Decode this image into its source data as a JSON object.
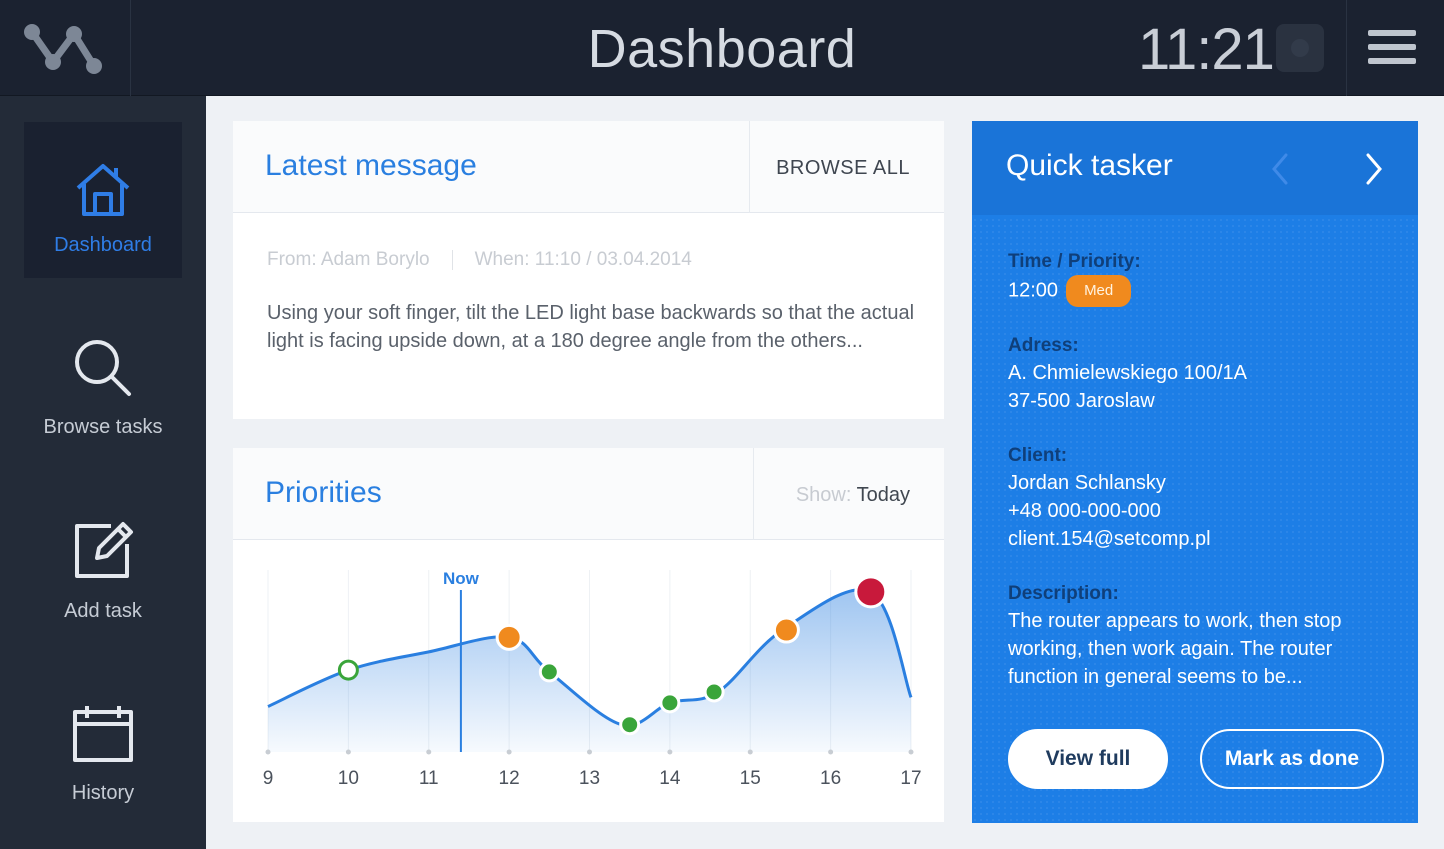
{
  "header": {
    "title": "Dashboard",
    "time": "11:21",
    "logo_icon": "network-logo-icon",
    "settings_icon": "toggle-icon",
    "menu_icon": "hamburger-menu-icon"
  },
  "sidebar": {
    "items": [
      {
        "label": "Dashboard",
        "icon": "home-icon",
        "active": true
      },
      {
        "label": "Browse tasks",
        "icon": "search-icon",
        "active": false
      },
      {
        "label": "Add task",
        "icon": "edit-icon",
        "active": false
      },
      {
        "label": "History",
        "icon": "calendar-icon",
        "active": false
      }
    ]
  },
  "latest_message": {
    "title": "Latest message",
    "browse_all": "BROWSE ALL",
    "from": "From: Adam Borylo",
    "when": "When: 11:10  /  03.04.2014",
    "body": "Using your soft finger, tilt the LED light base backwards so that the actual light is facing upside down, at a 180 degree angle from the others..."
  },
  "priorities": {
    "title": "Priorities",
    "show_label": "Show:",
    "show_value": "Today",
    "now_label": "Now"
  },
  "chart_data": {
    "type": "area",
    "x_ticks": [
      "9",
      "10",
      "11",
      "12",
      "13",
      "14",
      "15",
      "16",
      "17"
    ],
    "xlim": [
      9,
      17
    ],
    "now": 11.4,
    "grid": "vertical",
    "series_curve": [
      {
        "x": 9.0,
        "y": 0.25
      },
      {
        "x": 10.0,
        "y": 0.45
      },
      {
        "x": 11.0,
        "y": 0.55
      },
      {
        "x": 12.0,
        "y": 0.63
      },
      {
        "x": 12.5,
        "y": 0.44
      },
      {
        "x": 13.4,
        "y": 0.15
      },
      {
        "x": 14.0,
        "y": 0.27
      },
      {
        "x": 14.6,
        "y": 0.33
      },
      {
        "x": 15.4,
        "y": 0.67
      },
      {
        "x": 16.5,
        "y": 0.88
      },
      {
        "x": 17.0,
        "y": 0.3
      }
    ],
    "points": [
      {
        "x": 10.0,
        "y": 0.45,
        "level": "done"
      },
      {
        "x": 12.0,
        "y": 0.63,
        "level": "medium"
      },
      {
        "x": 12.5,
        "y": 0.44,
        "level": "low"
      },
      {
        "x": 13.5,
        "y": 0.15,
        "level": "low"
      },
      {
        "x": 14.0,
        "y": 0.27,
        "level": "low"
      },
      {
        "x": 14.55,
        "y": 0.33,
        "level": "low"
      },
      {
        "x": 15.45,
        "y": 0.67,
        "level": "medium"
      },
      {
        "x": 16.5,
        "y": 0.88,
        "level": "high"
      }
    ],
    "colors": {
      "line": "#2a7fe0",
      "low": "#3aa53a",
      "medium": "#f08a1e",
      "high": "#c8193b",
      "done": "#3aa53a"
    }
  },
  "tasker": {
    "title": "Quick tasker",
    "time_priority_label": "Time / Priority:",
    "time": "12:00",
    "priority": "Med",
    "address_label": "Adress:",
    "address_line1": "A. Chmielewskiego 100/1A",
    "address_line2": "37-500 Jaroslaw",
    "client_label": "Client:",
    "client_name": "Jordan Schlansky",
    "client_phone": "+48  000-000-000",
    "client_email": "client.154@setcomp.pl",
    "description_label": "Description:",
    "description": "The router appears to work, then stop working, then work again. The router function in general seems to be...",
    "view_full": "View full",
    "mark_done": "Mark as done",
    "prev_icon": "chevron-left-icon",
    "next_icon": "chevron-right-icon"
  },
  "colors": {
    "accent": "#2a7fe0",
    "tasker_bg": "#1d7ee6",
    "sidebar_bg": "#232b38",
    "header_bg": "#1b2230"
  }
}
